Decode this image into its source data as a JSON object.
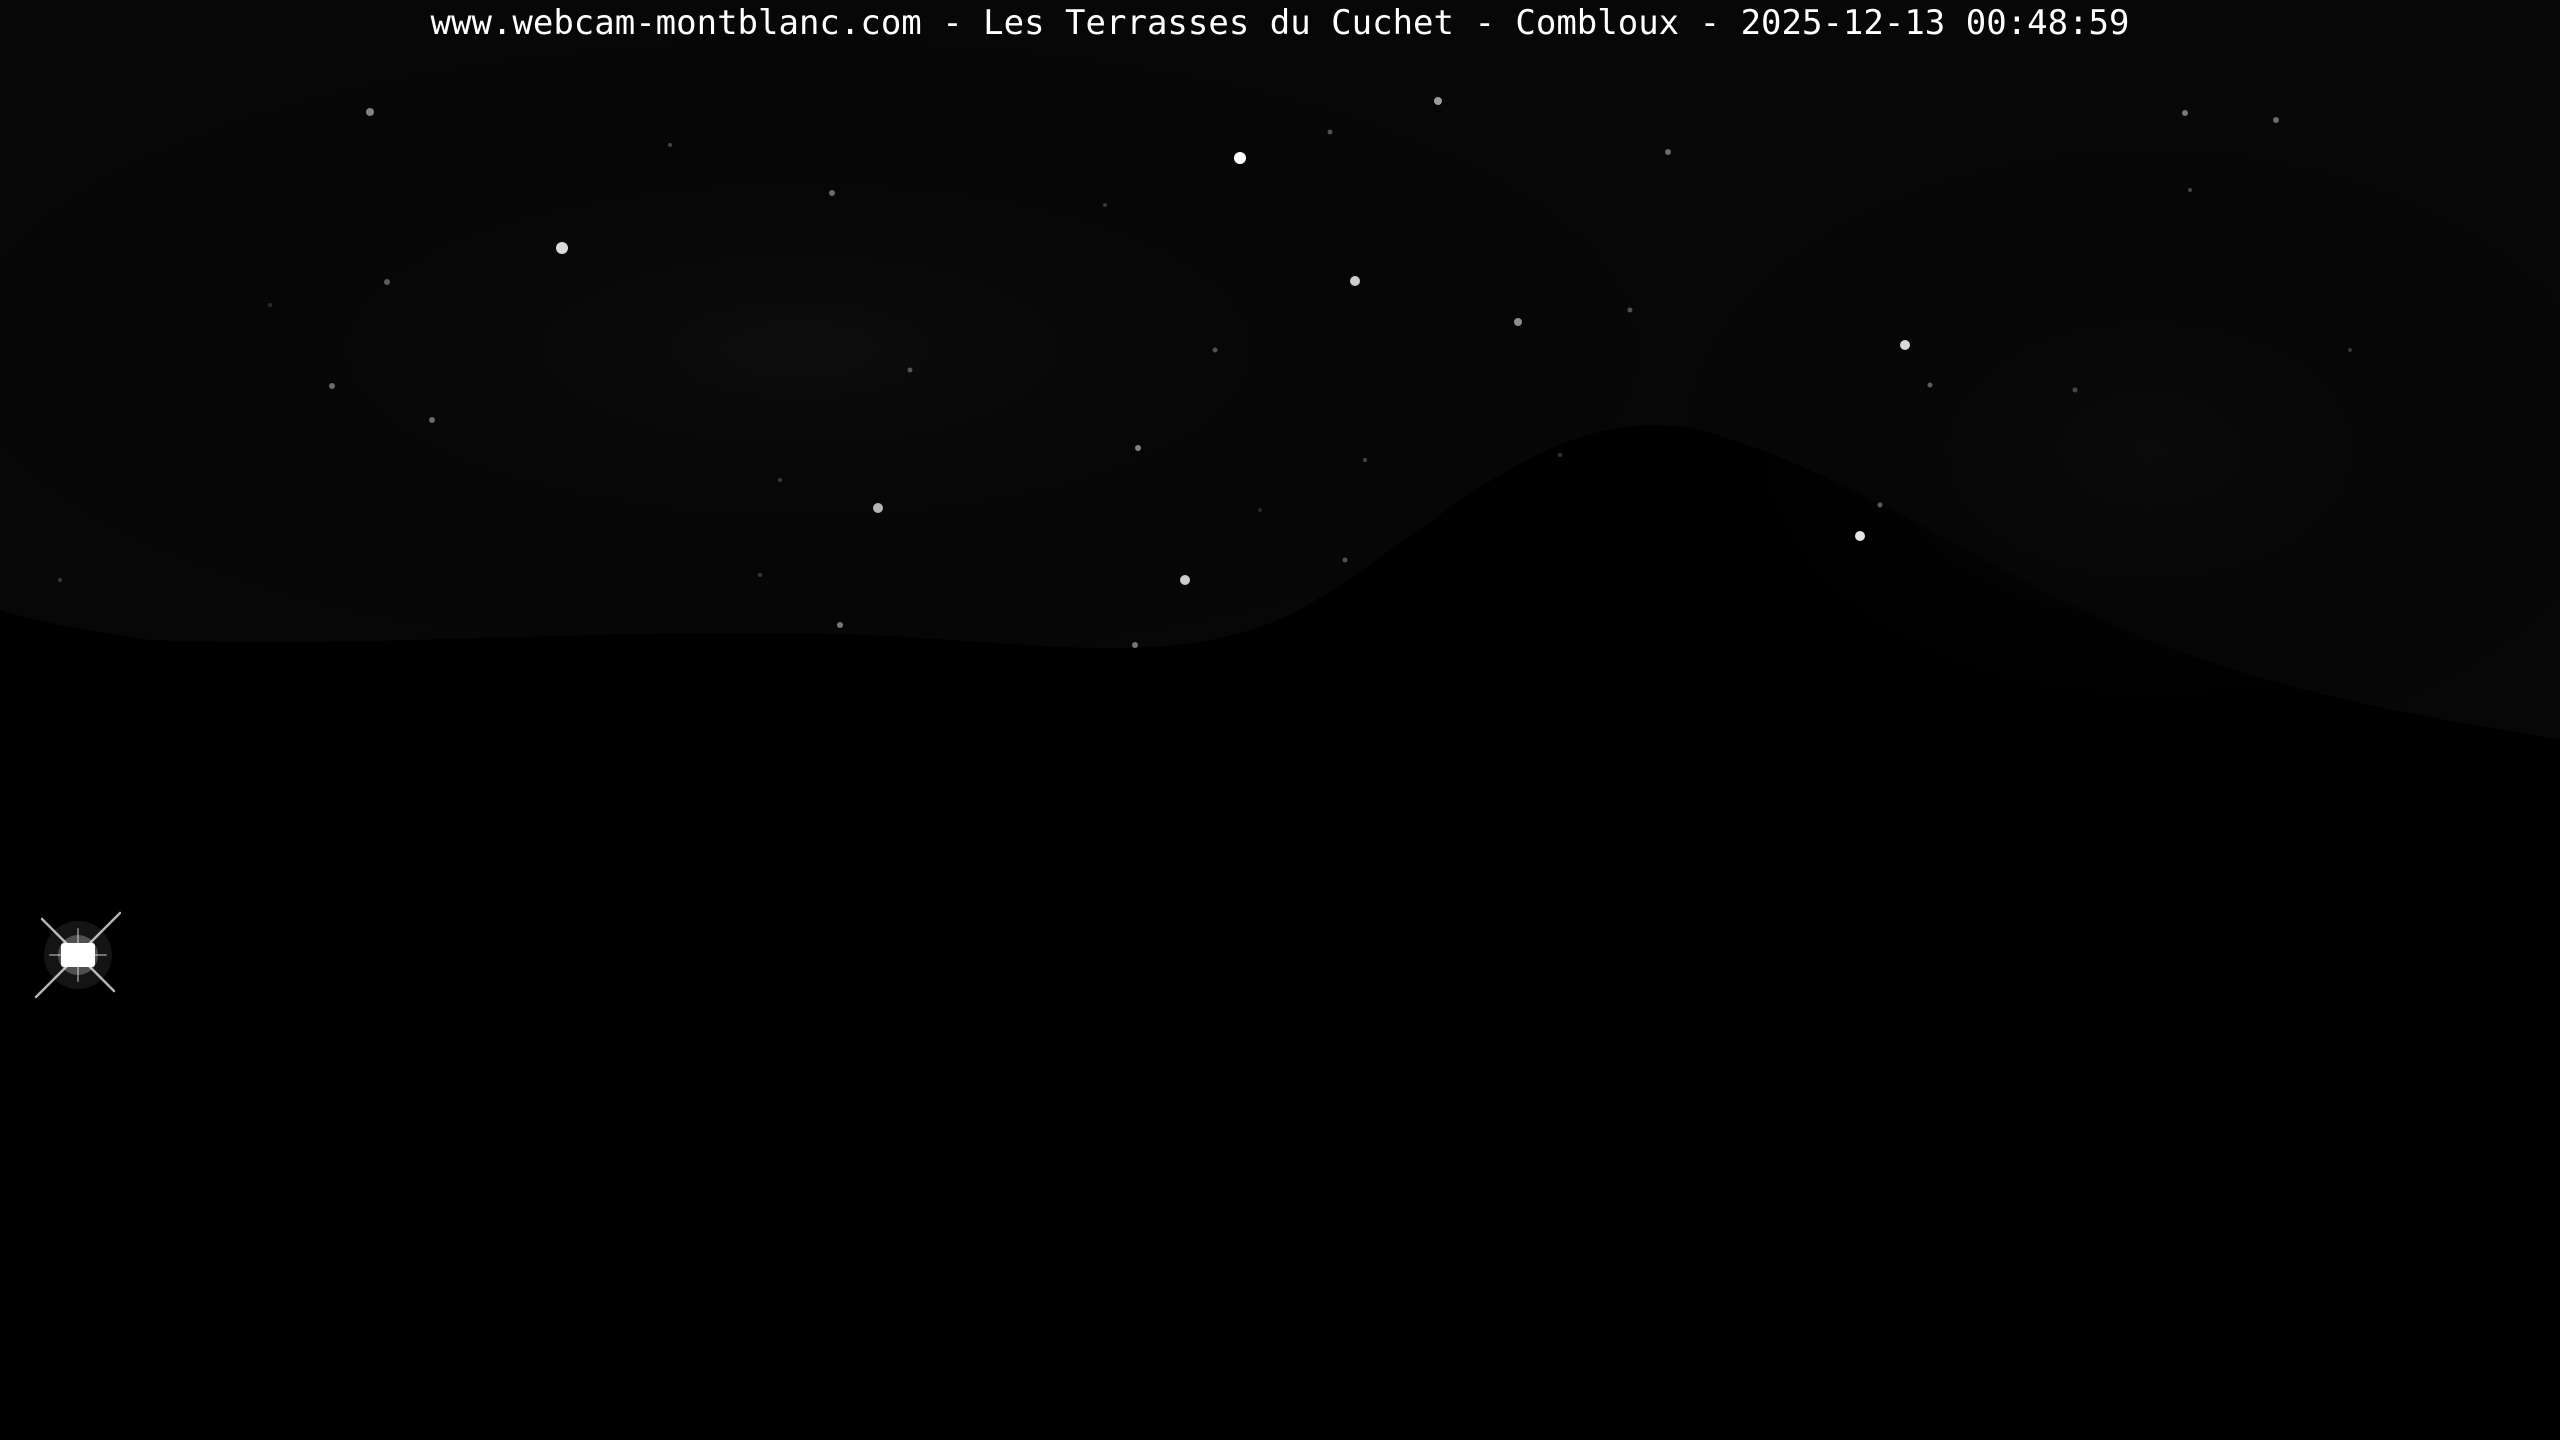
{
  "webcam": {
    "caption": "www.webcam-montblanc.com - Les Terrasses du Cuchet - Combloux - 2025-12-13 00:48:59"
  },
  "colors": {
    "background": "#000000",
    "caption_text": "#ffffff",
    "star": "#ffffff"
  }
}
